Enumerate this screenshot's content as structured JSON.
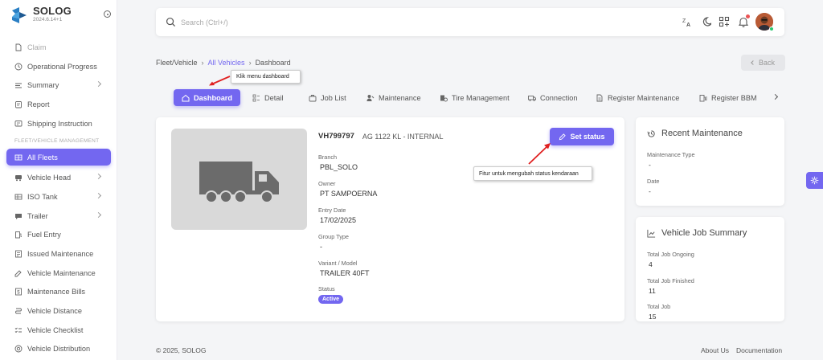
{
  "brand": {
    "name": "SOLOG",
    "version": "2024.6.14+1"
  },
  "colors": {
    "accent": "#7367f0",
    "callout_arrow": "#e02020",
    "notification": "#ea5455",
    "online": "#28c76f"
  },
  "sidebar": {
    "items": [
      {
        "label": "Claim",
        "icon": "file-icon"
      },
      {
        "label": "Operational Progress",
        "icon": "progress-icon"
      },
      {
        "label": "Summary",
        "icon": "summary-icon"
      },
      {
        "label": "Report",
        "icon": "report-icon"
      },
      {
        "label": "Shipping Instruction",
        "icon": "instruction-icon"
      }
    ],
    "section_label": "FLEET/VEHICLE MANAGEMENT",
    "fleet_items": [
      {
        "label": "All Fleets",
        "icon": "fleet-icon"
      },
      {
        "label": "Vehicle Head",
        "icon": "vehicle-head-icon"
      },
      {
        "label": "ISO Tank",
        "icon": "tank-icon"
      },
      {
        "label": "Trailer",
        "icon": "trailer-icon"
      },
      {
        "label": "Fuel Entry",
        "icon": "fuel-icon"
      },
      {
        "label": "Issued Maintenance",
        "icon": "issued-maintenance-icon"
      },
      {
        "label": "Vehicle Maintenance",
        "icon": "maintenance-icon"
      },
      {
        "label": "Maintenance Bills",
        "icon": "bills-icon"
      },
      {
        "label": "Vehicle Distance",
        "icon": "distance-icon"
      },
      {
        "label": "Vehicle Checklist",
        "icon": "checklist-icon"
      },
      {
        "label": "Vehicle Distribution",
        "icon": "distribution-icon"
      }
    ]
  },
  "search": {
    "placeholder": "Search (Ctrl+/)"
  },
  "breadcrumb": {
    "root": "Fleet/Vehicle",
    "link": "All Vehicles",
    "current": "Dashboard"
  },
  "back_label": "Back",
  "tabs": [
    {
      "label": "Dashboard",
      "icon": "home-icon"
    },
    {
      "label": "Detail",
      "icon": "detail-icon"
    },
    {
      "label": "Job List",
      "icon": "briefcase-icon"
    },
    {
      "label": "Maintenance",
      "icon": "maintenance-icon"
    },
    {
      "label": "Tire Management",
      "icon": "tire-icon"
    },
    {
      "label": "Connection",
      "icon": "truck-icon"
    },
    {
      "label": "Register Maintenance",
      "icon": "document-icon"
    },
    {
      "label": "Register BBM",
      "icon": "fuel-pump-icon"
    }
  ],
  "callouts": {
    "dashboard": "Klik menu dashboard",
    "status": "Fitur untuk mengubah status kendaraan"
  },
  "vehicle": {
    "id": "VH799797",
    "plate": "AG 1122 KL - INTERNAL",
    "set_status_label": "Set status",
    "fields": [
      {
        "label": "Branch",
        "value": "PBL_SOLO"
      },
      {
        "label": "Owner",
        "value": "PT SAMPOERNA"
      },
      {
        "label": "Entry Date",
        "value": "17/02/2025"
      },
      {
        "label": "Group Type",
        "value": "-"
      },
      {
        "label": "Variant / Model",
        "value": "TRAILER 40FT"
      }
    ],
    "status_label": "Status",
    "status_value": "Active"
  },
  "recent_maintenance": {
    "title": "Recent Maintenance",
    "fields": [
      {
        "label": "Maintenance Type",
        "value": "-"
      },
      {
        "label": "Date",
        "value": "-"
      }
    ]
  },
  "job_summary": {
    "title": "Vehicle Job Summary",
    "fields": [
      {
        "label": "Total Job Ongoing",
        "value": "4"
      },
      {
        "label": "Total Job Finished",
        "value": "11"
      },
      {
        "label": "Total Job",
        "value": "15"
      }
    ]
  },
  "footer": {
    "copyright": "© 2025, SOLOG",
    "about": "About Us",
    "documentation": "Documentation"
  }
}
